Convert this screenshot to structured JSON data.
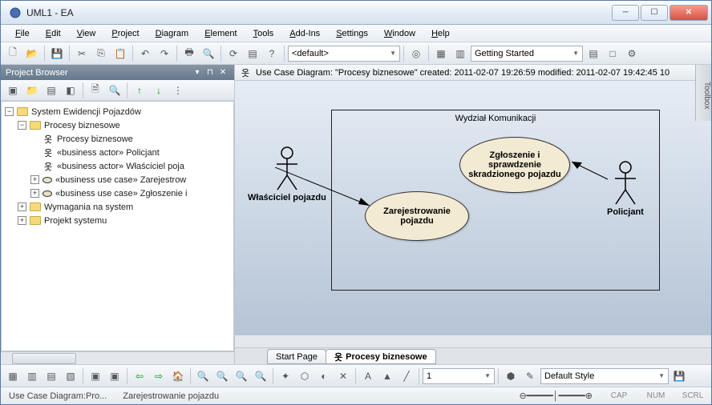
{
  "title": "UML1 - EA",
  "menu": [
    "File",
    "Edit",
    "View",
    "Project",
    "Diagram",
    "Element",
    "Tools",
    "Add-Ins",
    "Settings",
    "Window",
    "Help"
  ],
  "toolbar1": {
    "perspective": "<default>",
    "start": "Getting Started"
  },
  "projectBrowser": {
    "title": "Project Browser",
    "items": {
      "root": "System Ewidencji Pojazdów",
      "pkg1": "Procesy biznesowe",
      "diag": "Procesy biznesowe",
      "actor1": "«business actor» Policjant",
      "actor2": "«business actor» Właściciel poja",
      "uc1": "«business use case» Zarejestrow",
      "uc2": "«business use case» Zgłoszenie i",
      "pkg2": "Wymagania na system",
      "pkg3": "Projekt systemu"
    }
  },
  "canvas": {
    "header": "Use Case Diagram: \"Procesy biznesowe\"    created: 2011-02-07 19:26:59    modified: 2011-02-07 19:42:45   10",
    "boundary": "Wydział Komunikacji",
    "actorLeft": "Właściciel pojazdu",
    "actorRight": "Policjant",
    "usecase1": "Zarejestrowanie pojazdu",
    "usecase2": "Zgłoszenie i sprawdzenie skradzionego pojazdu",
    "tab1": "Start Page",
    "tab2": "Procesy biznesowe"
  },
  "bottom": {
    "style": "Default Style",
    "num": "1"
  },
  "status": {
    "left": "Use Case Diagram:Pro...",
    "center": "Zarejestrowanie pojazdu",
    "cap": "CAP",
    "numlock": "NUM",
    "scrl": "SCRL"
  }
}
